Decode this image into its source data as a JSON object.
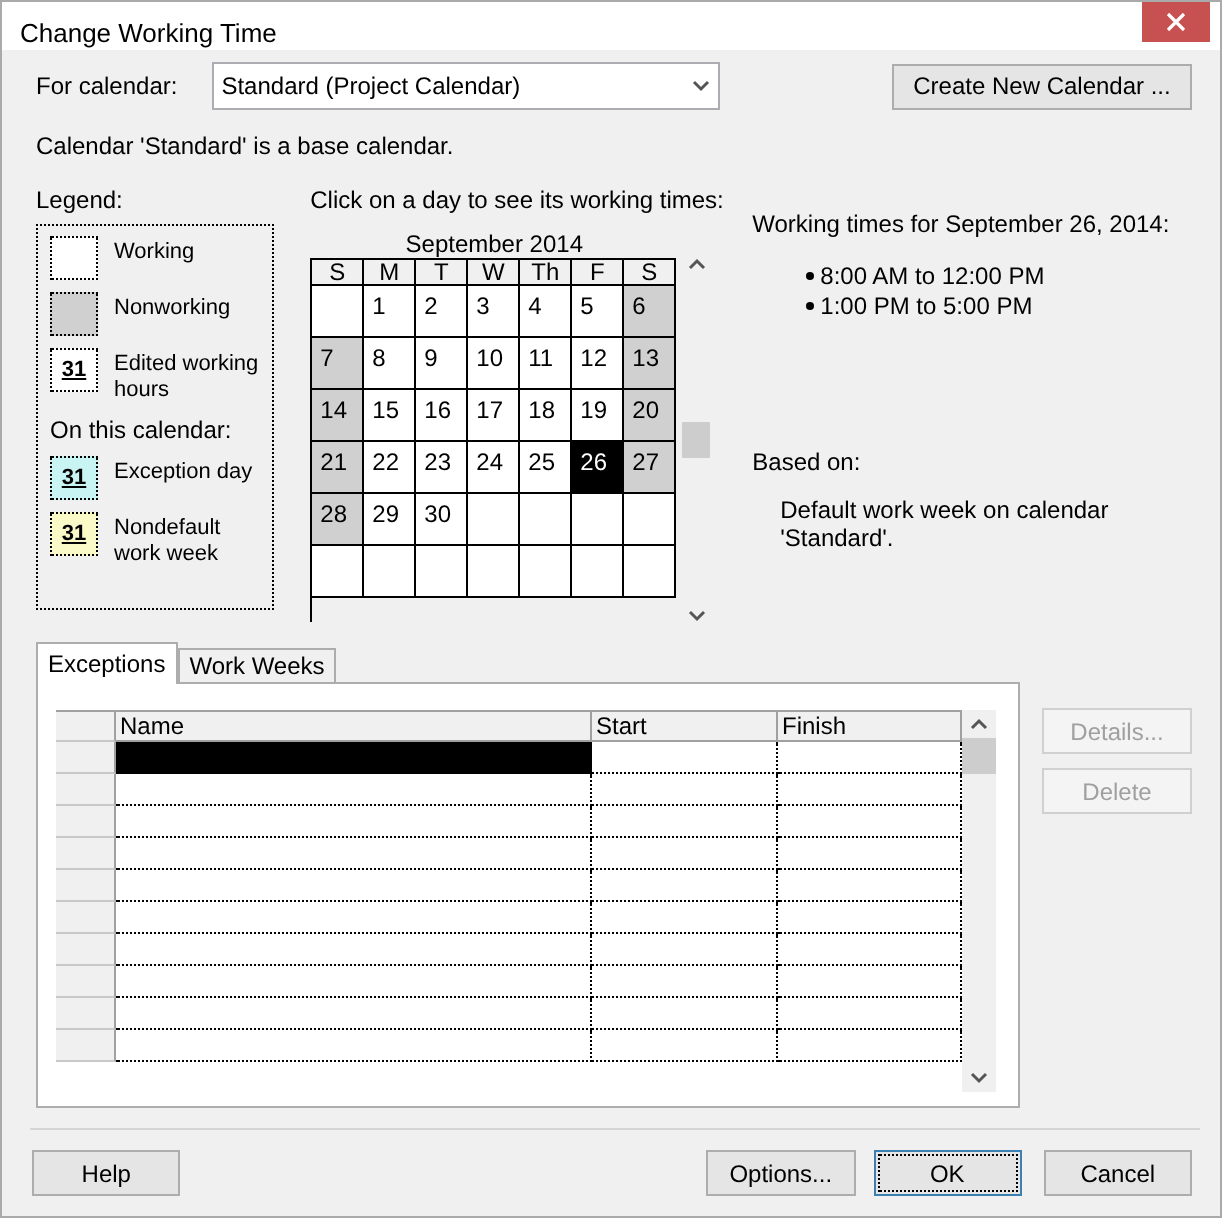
{
  "window": {
    "title": "Change Working Time"
  },
  "calendar_select": {
    "label": "For calendar:",
    "value": "Standard (Project Calendar)"
  },
  "create_button": "Create New Calendar ...",
  "base_note": "Calendar 'Standard' is a base calendar.",
  "legend": {
    "title": "Legend:",
    "entries": [
      {
        "kind": "working",
        "label": "Working"
      },
      {
        "kind": "nonworking",
        "label": "Nonworking"
      },
      {
        "kind": "edited",
        "label": "Edited working hours",
        "swatch_text": "31"
      },
      {
        "kind": "heading",
        "label": "On this calendar:"
      },
      {
        "kind": "exception",
        "label": "Exception day",
        "swatch_text": "31"
      },
      {
        "kind": "nondefault",
        "label": "Nondefault work week",
        "swatch_text": "31"
      }
    ]
  },
  "calendar": {
    "hint": "Click on a day to see its working times:",
    "month": "September 2014",
    "weekdays": [
      "S",
      "M",
      "T",
      "W",
      "Th",
      "F",
      "S"
    ],
    "weeks": [
      [
        {
          "kind": "working"
        },
        {
          "kind": "working",
          "label": "1"
        },
        {
          "kind": "working",
          "label": "2"
        },
        {
          "kind": "working",
          "label": "3"
        },
        {
          "kind": "working",
          "label": "4"
        },
        {
          "kind": "working",
          "label": "5"
        },
        {
          "kind": "nonworking",
          "label": "6"
        }
      ],
      [
        {
          "kind": "nonworking",
          "label": "7"
        },
        {
          "kind": "working",
          "label": "8"
        },
        {
          "kind": "working",
          "label": "9"
        },
        {
          "kind": "working",
          "label": "10"
        },
        {
          "kind": "working",
          "label": "11"
        },
        {
          "kind": "working",
          "label": "12"
        },
        {
          "kind": "nonworking",
          "label": "13"
        }
      ],
      [
        {
          "kind": "nonworking",
          "label": "14"
        },
        {
          "kind": "working",
          "label": "15"
        },
        {
          "kind": "working",
          "label": "16"
        },
        {
          "kind": "working",
          "label": "17"
        },
        {
          "kind": "working",
          "label": "18"
        },
        {
          "kind": "working",
          "label": "19"
        },
        {
          "kind": "nonworking",
          "label": "20"
        }
      ],
      [
        {
          "kind": "nonworking",
          "label": "21"
        },
        {
          "kind": "working",
          "label": "22"
        },
        {
          "kind": "working",
          "label": "23"
        },
        {
          "kind": "working",
          "label": "24"
        },
        {
          "kind": "working",
          "label": "25"
        },
        {
          "kind": "selected",
          "label": "26"
        },
        {
          "kind": "nonworking",
          "label": "27"
        }
      ],
      [
        {
          "kind": "nonworking",
          "label": "28"
        },
        {
          "kind": "working",
          "label": "29"
        },
        {
          "kind": "working",
          "label": "30"
        },
        {
          "kind": "working"
        },
        {
          "kind": "working"
        },
        {
          "kind": "working"
        },
        {
          "kind": "working"
        }
      ],
      [
        {
          "kind": "working"
        },
        {
          "kind": "working"
        },
        {
          "kind": "working"
        },
        {
          "kind": "working"
        },
        {
          "kind": "working"
        },
        {
          "kind": "working"
        },
        {
          "kind": "working"
        }
      ]
    ]
  },
  "working_times": {
    "title": "Working times for September 26, 2014:",
    "times": [
      "8:00 AM to 12:00 PM",
      "1:00 PM to 5:00 PM"
    ],
    "based_on_label": "Based on:",
    "based_on": "Default work week on calendar 'Standard'."
  },
  "tabs": [
    {
      "label": "Exceptions",
      "selected": true
    },
    {
      "label": "Work Weeks",
      "selected": false
    }
  ],
  "table": {
    "columns": [
      "Name",
      "Start",
      "Finish"
    ],
    "rows": [
      {
        "selected": true
      },
      {
        "selected": false
      },
      {
        "selected": false
      },
      {
        "selected": false
      },
      {
        "selected": false
      },
      {
        "selected": false
      },
      {
        "selected": false
      },
      {
        "selected": false
      },
      {
        "selected": false
      },
      {
        "selected": false
      }
    ]
  },
  "side_buttons": [
    {
      "label": "Details...",
      "disabled": true
    },
    {
      "label": "Delete",
      "disabled": true
    }
  ],
  "footer_buttons": [
    {
      "label": "Help",
      "default": false
    },
    {
      "label": "Options...",
      "default": false
    },
    {
      "label": "OK",
      "default": true
    },
    {
      "label": "Cancel",
      "default": false
    }
  ]
}
